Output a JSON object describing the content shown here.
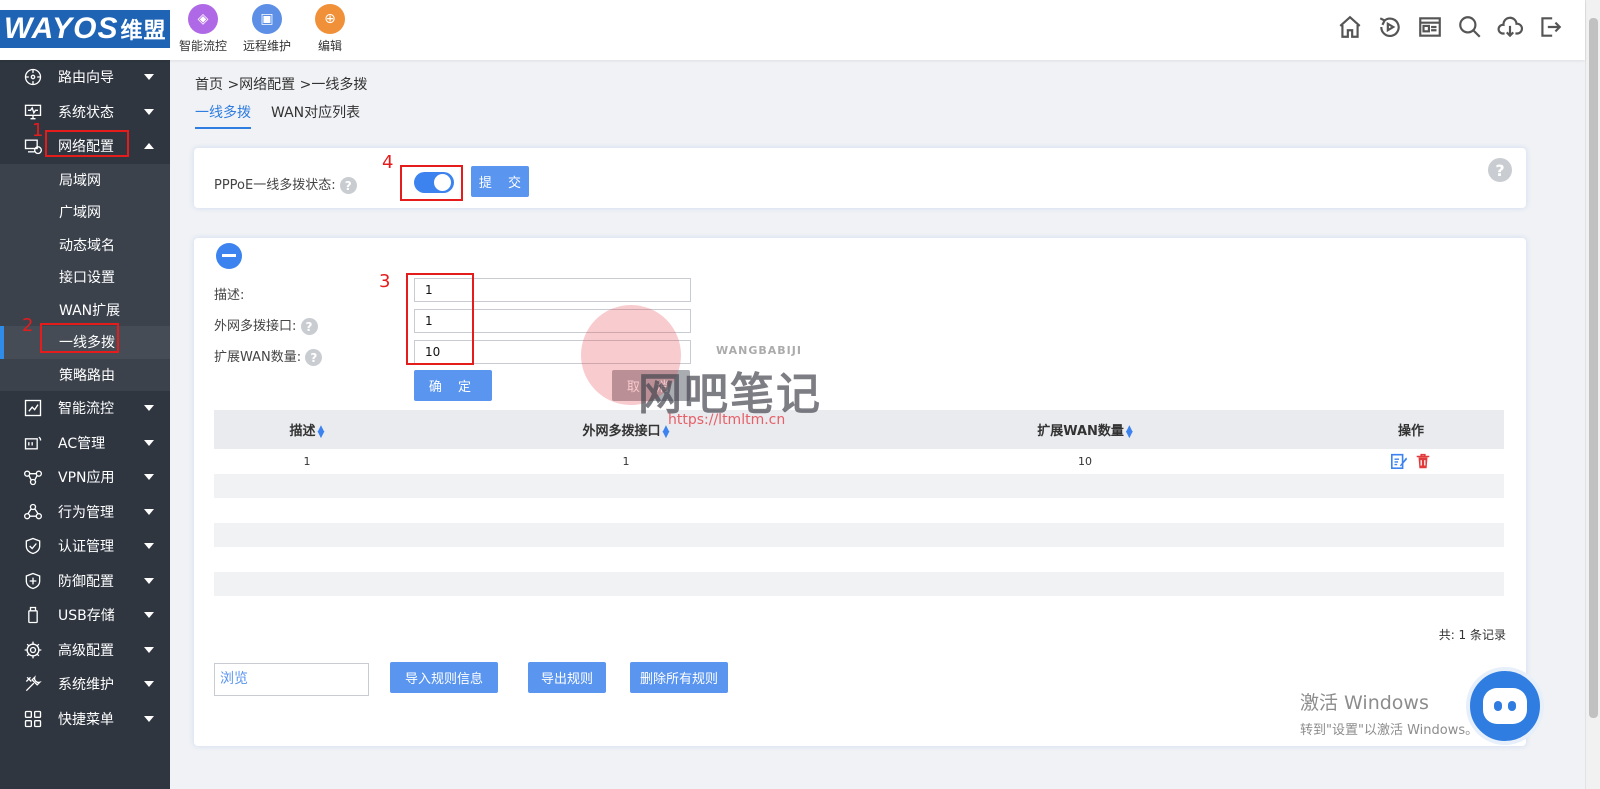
{
  "brand": {
    "logo_text": "WAYOS",
    "logo_cn": "维盟"
  },
  "quick_links": [
    {
      "label": "智能流控",
      "icon": "flow-control-icon"
    },
    {
      "label": "远程维护",
      "icon": "remote-maintain-icon"
    },
    {
      "label": "编辑",
      "icon": "edit-icon"
    }
  ],
  "toolbar_icons": [
    "home-icon",
    "refresh-icon",
    "news-icon",
    "search-icon",
    "download-icon",
    "logout-icon"
  ],
  "sidebar": {
    "items": [
      {
        "label": "路由向导",
        "icon": "wizard-icon"
      },
      {
        "label": "系统状态",
        "icon": "monitor-icon"
      },
      {
        "label": "网络配置",
        "icon": "network-icon",
        "expanded": true,
        "children": [
          "局域网",
          "广域网",
          "动态域名",
          "接口设置",
          "WAN扩展",
          "一线多拨",
          "策略路由"
        ],
        "active_child": "一线多拨"
      },
      {
        "label": "智能流控",
        "icon": "flow-icon"
      },
      {
        "label": "AC管理",
        "icon": "ac-icon"
      },
      {
        "label": "VPN应用",
        "icon": "vpn-icon"
      },
      {
        "label": "行为管理",
        "icon": "behavior-icon"
      },
      {
        "label": "认证管理",
        "icon": "shield-check-icon"
      },
      {
        "label": "防御配置",
        "icon": "shield-plus-icon"
      },
      {
        "label": "USB存储",
        "icon": "usb-icon"
      },
      {
        "label": "高级配置",
        "icon": "gear-icon"
      },
      {
        "label": "系统维护",
        "icon": "tools-icon"
      },
      {
        "label": "快捷菜单",
        "icon": "grid-icon"
      }
    ]
  },
  "annotations": [
    "1",
    "2",
    "3",
    "4"
  ],
  "breadcrumb": "首页 >网络配置 >一线多拨",
  "tabs": [
    {
      "label": "一线多拨",
      "active": true
    },
    {
      "label": "WAN对应列表",
      "active": false
    }
  ],
  "status_panel": {
    "label": "PPPoE一线多拨状态:",
    "toggle_on": true,
    "submit_label": "提 交",
    "help": "?"
  },
  "form": {
    "fields": [
      {
        "label": "描述:",
        "value": "1"
      },
      {
        "label": "外网多拨接口:",
        "value": "1"
      },
      {
        "label": "扩展WAN数量:",
        "value": "10"
      }
    ],
    "confirm_label": "确 定",
    "cancel_label": "取 消"
  },
  "table": {
    "headers": [
      "描述",
      "外网多拨接口",
      "扩展WAN数量",
      "操作"
    ],
    "rows": [
      {
        "desc": "1",
        "interface": "1",
        "wan_count": "10"
      }
    ],
    "total": "共: 1 条记录"
  },
  "import_export": {
    "browse_placeholder": "浏览",
    "import_label": "导入规则信息",
    "export_label": "导出规则",
    "delete_all_label": "删除所有规则"
  },
  "watermark": {
    "big": "网吧笔记",
    "small": "WANGBABIJI",
    "url": "https://ltmltm.cn"
  },
  "windows_activation": {
    "line1": "激活 Windows",
    "line2": "转到\"设置\"以激活 Windows。"
  },
  "colors": {
    "brand_blue": "#1f64b4",
    "accent": "#3c83f0",
    "sidebar_bg": "#2f3640",
    "annotation_red": "#e51c1c"
  }
}
